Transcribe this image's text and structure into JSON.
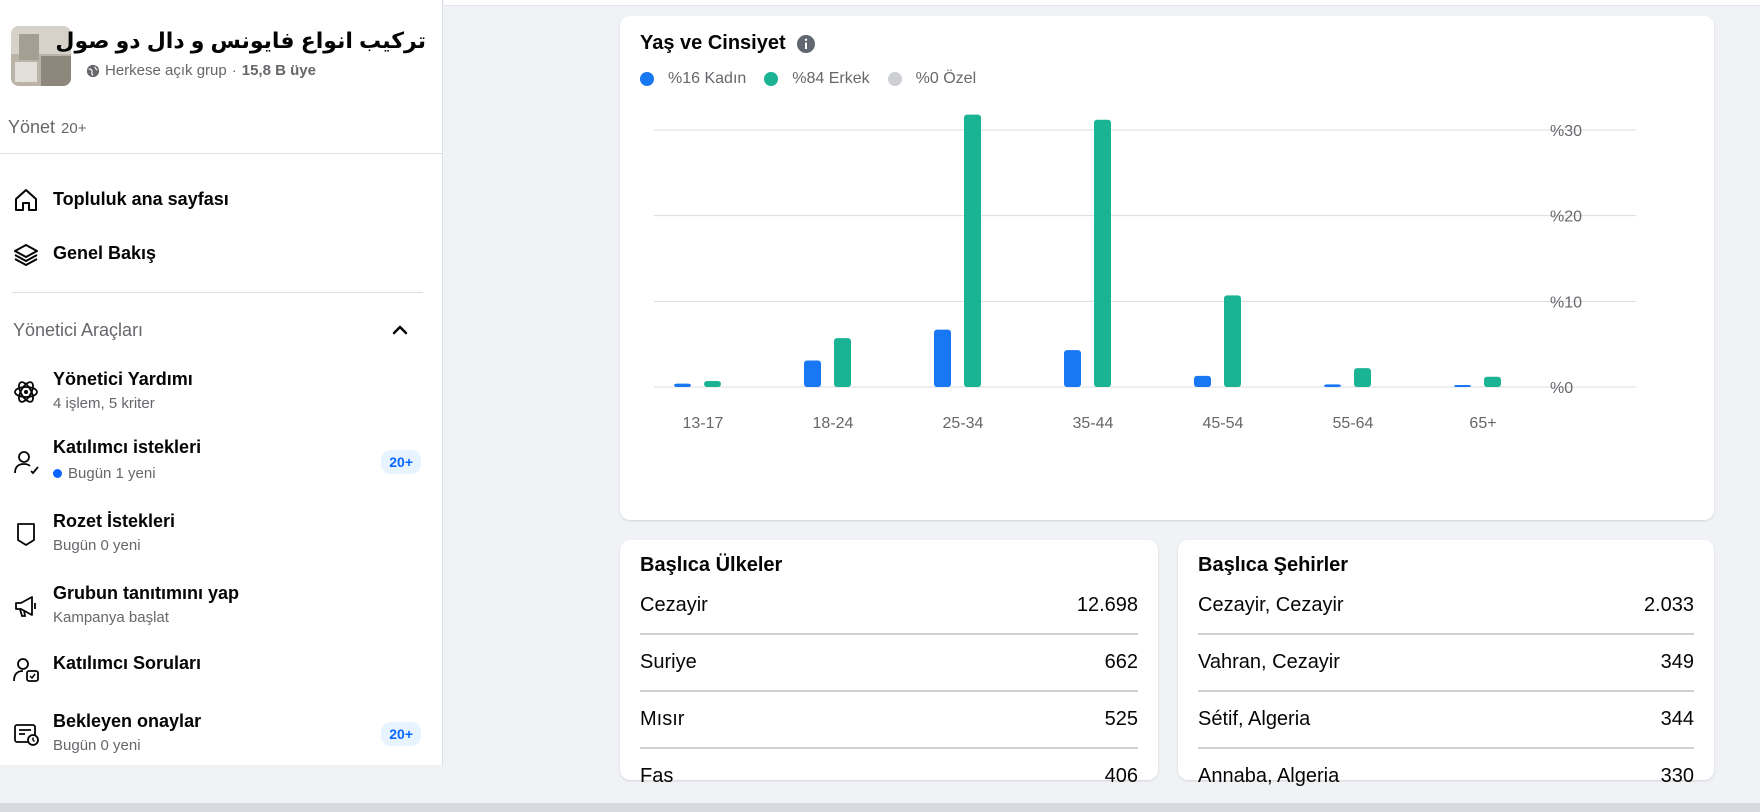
{
  "group": {
    "name": "تركيب انواع فايونس و دال دو صول",
    "privacy": "Herkese açık grup",
    "separator": "·",
    "members": "15,8 B üye"
  },
  "manage": {
    "label": "Yönet",
    "count": "20+"
  },
  "nav": [
    {
      "title": "Topluluk ana sayfası",
      "icon": "home-icon"
    },
    {
      "title": "Genel Bakış",
      "icon": "layers-icon"
    }
  ],
  "admin_tools": {
    "title": "Yönetici Araçları",
    "items": [
      {
        "title": "Yönetici Yardımı",
        "sub": "4 işlem, 5 kriter",
        "icon": "atom-icon",
        "badge": "",
        "dot": false
      },
      {
        "title": "Katılımcı istekleri",
        "sub": "Bugün 1 yeni",
        "icon": "person-check-icon",
        "badge": "20+",
        "dot": true
      },
      {
        "title": "Rozet İstekleri",
        "sub": "Bugün 0 yeni",
        "icon": "shield-badge-icon",
        "badge": "",
        "dot": false
      },
      {
        "title": "Grubun tanıtımını yap",
        "sub": "Kampanya başlat",
        "icon": "megaphone-icon",
        "badge": "",
        "dot": false
      },
      {
        "title": "Katılımcı Soruları",
        "sub": "",
        "icon": "person-question-icon",
        "badge": "",
        "dot": false
      },
      {
        "title": "Bekleyen onaylar",
        "sub": "Bugün 0 yeni",
        "icon": "pending-list-icon",
        "badge": "20+",
        "dot": false
      }
    ]
  },
  "age_gender": {
    "title": "Yaş ve Cinsiyet",
    "legend": [
      {
        "label": "%16 Kadın",
        "color": "#1877f2"
      },
      {
        "label": "%84 Erkek",
        "color": "#1ab394"
      },
      {
        "label": "%0 Özel",
        "color": "#ced0d4"
      }
    ]
  },
  "chart_data": {
    "type": "bar",
    "title": "Yaş ve Cinsiyet",
    "categories": [
      "13-17",
      "18-24",
      "25-34",
      "35-44",
      "45-54",
      "55-64",
      "65+"
    ],
    "series": [
      {
        "name": "Kadın",
        "color": "#1877f2",
        "values": [
          0.4,
          3.1,
          6.7,
          4.3,
          1.3,
          0.3,
          0.2
        ]
      },
      {
        "name": "Erkek",
        "color": "#1ab394",
        "values": [
          0.7,
          5.7,
          31.8,
          31.2,
          10.7,
          2.2,
          1.2
        ]
      }
    ],
    "yticks": [
      "%0",
      "%10",
      "%20",
      "%30"
    ],
    "ytick_values": [
      0,
      10,
      20,
      30
    ],
    "ylim": [
      0,
      32
    ]
  },
  "countries": {
    "title": "Başlıca Ülkeler",
    "rows": [
      {
        "name": "Cezayir",
        "value": "12.698"
      },
      {
        "name": "Suriye",
        "value": "662"
      },
      {
        "name": "Mısır",
        "value": "525"
      },
      {
        "name": "Fas",
        "value": "406"
      }
    ]
  },
  "cities": {
    "title": "Başlıca Şehirler",
    "rows": [
      {
        "name": "Cezayir, Cezayir",
        "value": "2.033"
      },
      {
        "name": "Vahran, Cezayir",
        "value": "349"
      },
      {
        "name": "Sétif, Algeria",
        "value": "344"
      },
      {
        "name": "Annaba, Algeria",
        "value": "330"
      }
    ]
  }
}
